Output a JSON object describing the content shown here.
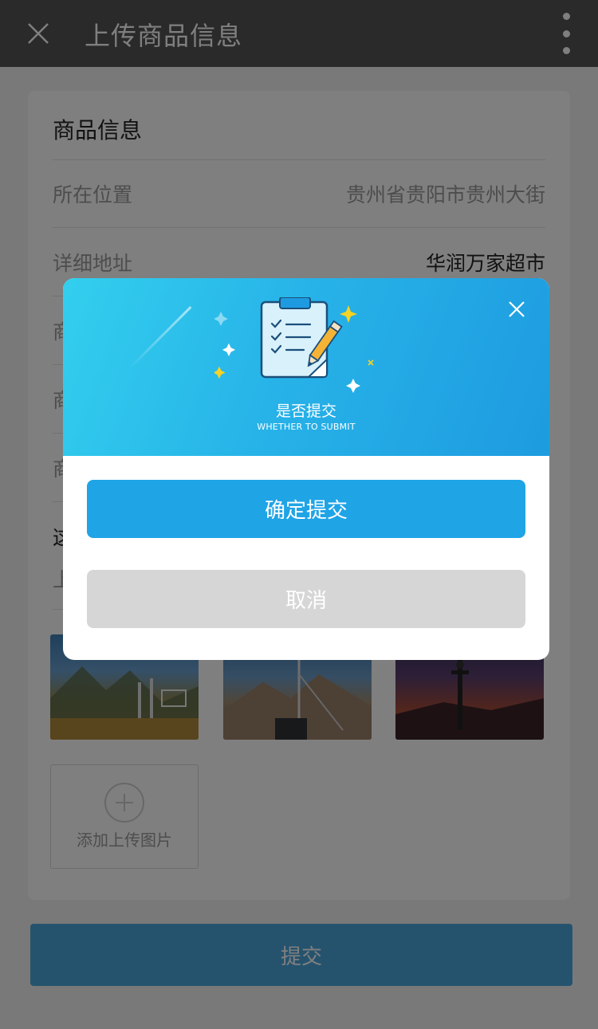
{
  "appbar": {
    "title": "上传商品信息",
    "close_icon": "close-icon",
    "more_icon": "more-vertical-icon"
  },
  "form": {
    "section_title": "商品信息",
    "rows": [
      {
        "label": "所在位置",
        "value": "贵州省贵阳市贵州大街"
      },
      {
        "label": "详细地址",
        "value": "华润万家超市"
      },
      {
        "label": "商",
        "value": ""
      },
      {
        "label": "商",
        "value": ""
      },
      {
        "label": "商",
        "value": ""
      },
      {
        "label": "这",
        "value": ""
      }
    ],
    "upload_label": "上",
    "add_photo_label": "添加上传图片"
  },
  "submit_bar": {
    "label": "提交"
  },
  "modal": {
    "title": "是否提交",
    "subtitle": "WHETHER TO SUBMIT",
    "confirm_label": "确定提交",
    "cancel_label": "取消"
  },
  "colors": {
    "appbar": "#555555",
    "primary": "#1fa4e6",
    "cancel": "#d6d6d6",
    "header_gradient_start": "#33cfee",
    "header_gradient_end": "#1e9be0"
  }
}
